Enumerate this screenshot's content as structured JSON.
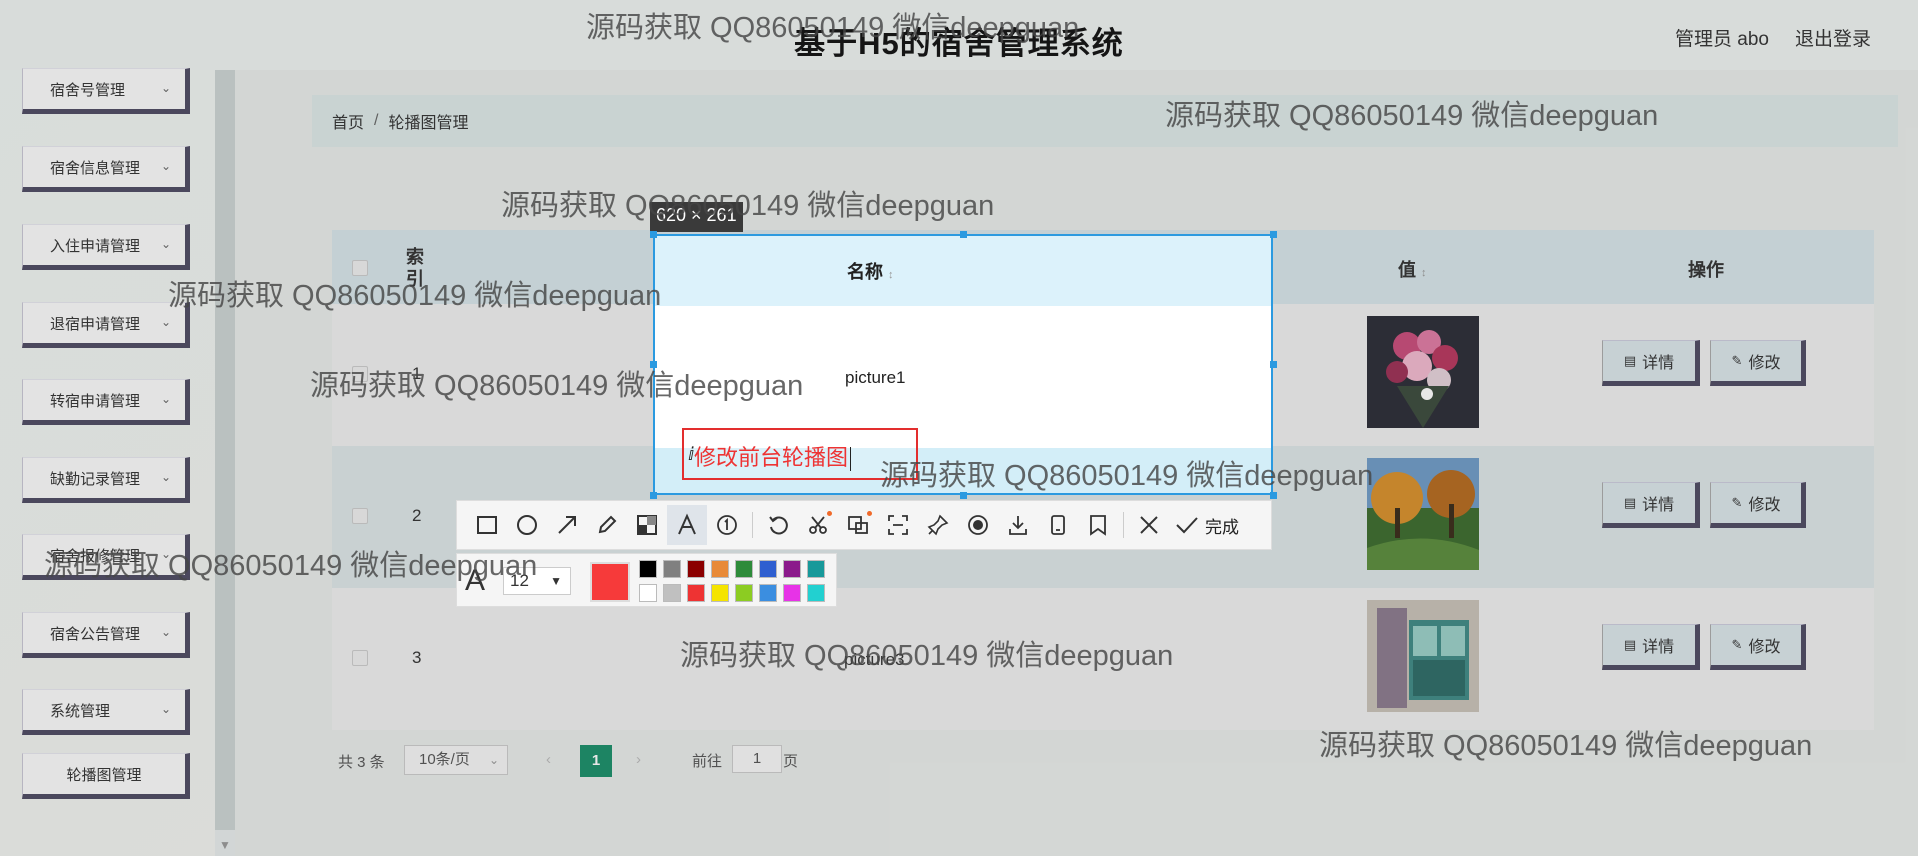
{
  "header": {
    "title": "基于H5的宿舍管理系统",
    "user": "管理员 abo",
    "logout": "退出登录"
  },
  "sidebar": {
    "items": [
      {
        "label": "宿舍号管理"
      },
      {
        "label": "宿舍信息管理"
      },
      {
        "label": "入住申请管理"
      },
      {
        "label": "退宿申请管理"
      },
      {
        "label": "转宿申请管理"
      },
      {
        "label": "缺勤记录管理"
      },
      {
        "label": "宿舍报修管理"
      },
      {
        "label": "宿舍公告管理"
      },
      {
        "label": "系统管理"
      }
    ],
    "sub_item": "轮播图管理"
  },
  "breadcrumb": {
    "home": "首页",
    "sep": "/",
    "current": "轮播图管理"
  },
  "table": {
    "headers": {
      "index": "索引",
      "name": "名称",
      "value": "值",
      "actions": "操作"
    },
    "rows": [
      {
        "index": "1",
        "name": "picture1"
      },
      {
        "index": "2",
        "name": ""
      },
      {
        "index": "3",
        "name": "picture3"
      }
    ],
    "detail_label": "详情",
    "edit_label": "修改"
  },
  "pagination": {
    "total": "共 3 条",
    "page_size": "10条/页",
    "current_page": "1",
    "goto_label": "前往",
    "goto_value": "1",
    "page_suffix": "页"
  },
  "screenshot_tool": {
    "dimensions": "620 × 261",
    "annotation_text": "修改前台轮播图",
    "done_label": "完成",
    "font_size": "12",
    "selected_color": "#f63a3a",
    "colors_row1": [
      "#000000",
      "#808080",
      "#8b0000",
      "#e88a38",
      "#2e8b3a",
      "#2f5fd0",
      "#8b1a8b",
      "#17999a"
    ],
    "colors_row2": [
      "#ffffff",
      "#c0c0c0",
      "#ee3333",
      "#f5e400",
      "#8ccc22",
      "#3b8ee0",
      "#e733e7",
      "#22d0d0"
    ]
  },
  "watermark": "源码获取 QQ86050149 微信deepguan"
}
